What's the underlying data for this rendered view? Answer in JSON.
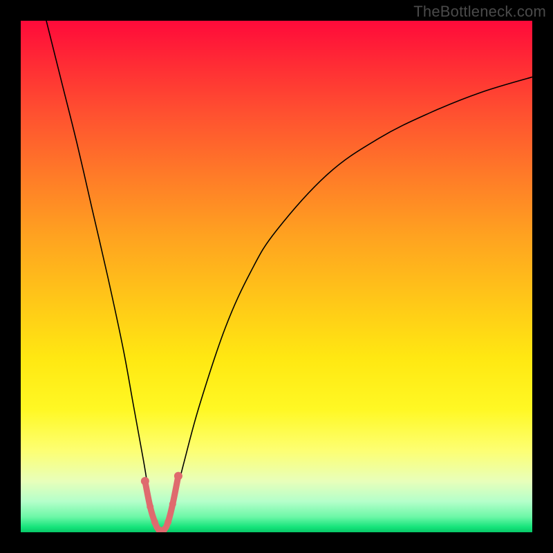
{
  "watermark": "TheBottleneck.com",
  "colors": {
    "frame": "#000000",
    "curve": "#000000",
    "marker": "#df6a6e",
    "watermark": "#4a4a4a"
  },
  "chart_data": {
    "type": "line",
    "title": "",
    "xlabel": "",
    "ylabel": "",
    "xlim": [
      0,
      100
    ],
    "ylim": [
      0,
      100
    ],
    "grid": false,
    "legend": false,
    "annotations": [
      "TheBottleneck.com"
    ],
    "series": [
      {
        "name": "bottleneck-curve",
        "x": [
          5,
          8,
          11,
          14,
          17,
          20,
          22,
          24,
          25,
          26,
          27,
          28,
          29,
          30,
          32,
          35,
          40,
          45,
          50,
          60,
          70,
          80,
          90,
          100
        ],
        "y": [
          100,
          88,
          76,
          63,
          50,
          36,
          25,
          14,
          8,
          3,
          0,
          0,
          2,
          6,
          14,
          25,
          40,
          51,
          59,
          70,
          77,
          82,
          86,
          89
        ]
      }
    ],
    "markers": {
      "name": "highlight",
      "x": [
        24.3,
        25.3,
        26.2,
        27.0,
        28.0,
        28.8,
        29.7,
        30.8
      ],
      "y": [
        10.0,
        5.0,
        2.0,
        0.5,
        0.5,
        2.0,
        5.5,
        11.0
      ]
    },
    "minimum_x": 27.5
  }
}
